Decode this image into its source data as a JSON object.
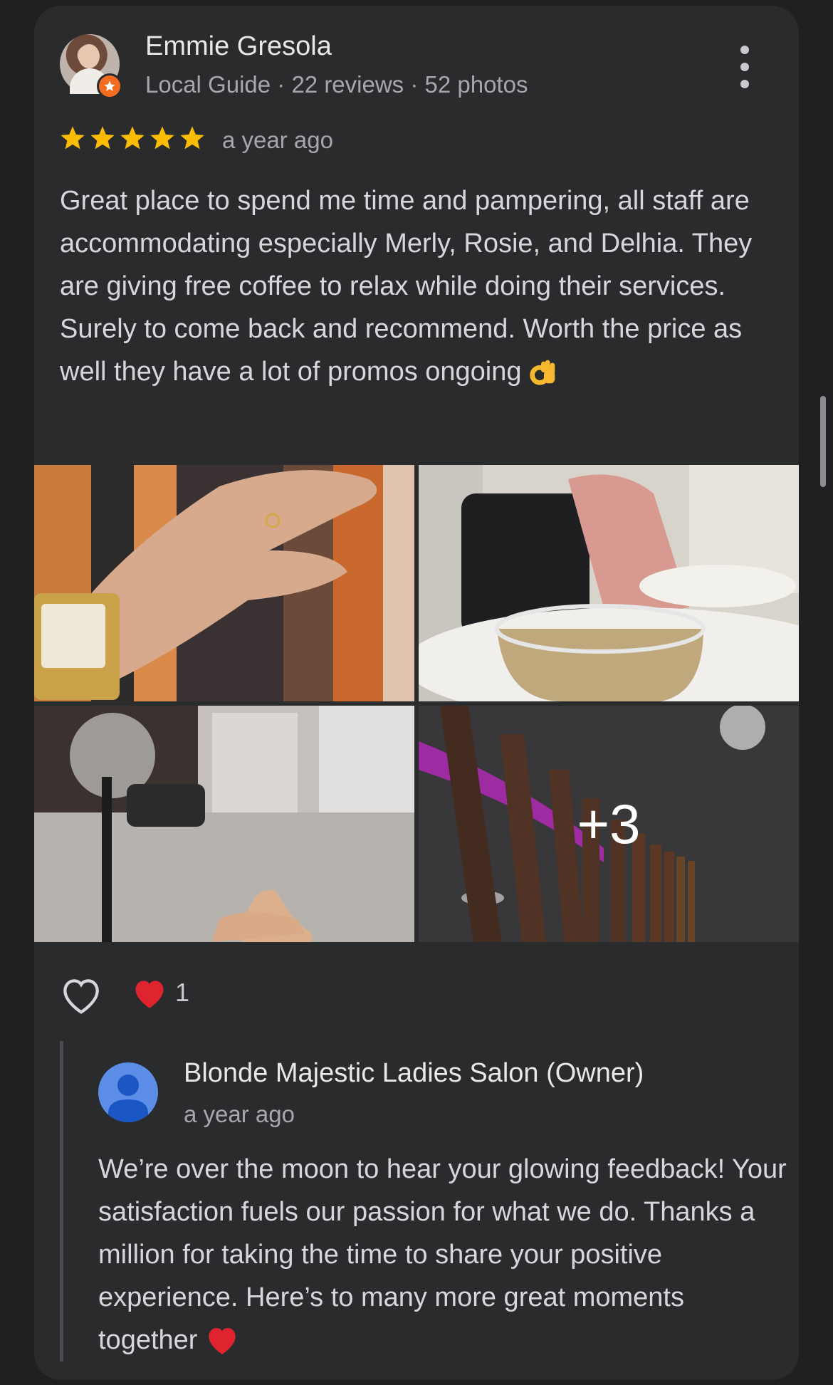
{
  "review": {
    "reviewer_name": "Emmie Gresola",
    "reviewer_meta": "Local Guide · 22 reviews · 52 photos",
    "rating": 5,
    "time": "a year ago",
    "text": "Great place to spend me time and pampering, all staff are accommodating especially Merly, Rosie, and Delhia. They are giving free coffee to relax while doing their services. Surely to come back and recommend. Worth the price as well they have a lot of promos ongoing",
    "photos_more_label": "+3",
    "reaction_count": "1"
  },
  "owner_reply": {
    "name": "Blonde Majestic Ladies Salon (Owner)",
    "time": "a year ago",
    "text": "We’re over the moon to hear your glowing feedback! Your satisfaction fuels our passion for what we do. Thanks a million for taking the time to share your positive experience. Here’s to many more great moments together"
  },
  "colors": {
    "card_bg": "#2a2b2d",
    "star": "#fbbc04",
    "guide_badge": "#f26d21",
    "owner_avatar": "#5c8ee8"
  }
}
